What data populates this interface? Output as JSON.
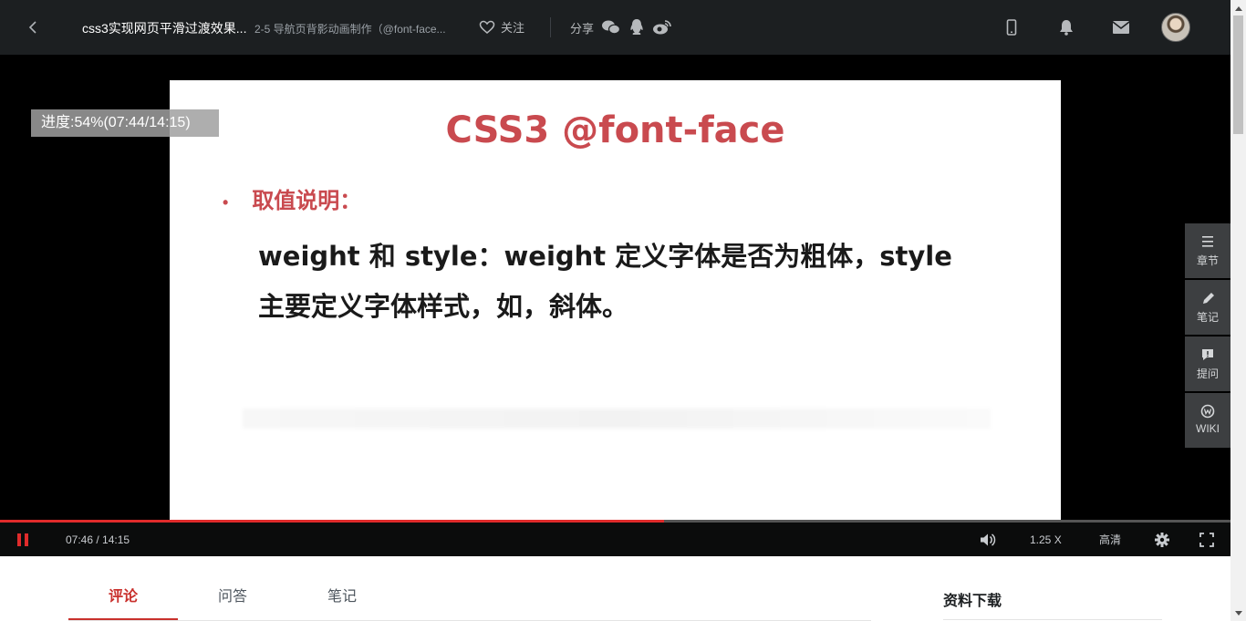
{
  "header": {
    "course_title": "css3实现网页平滑过渡效果...",
    "lesson_title": "2-5 导航页背影动画制作（@font-face...",
    "follow_label": "关注",
    "share_label": "分享"
  },
  "player": {
    "progress_tip": "进度:54%(07:44/14:15)",
    "slide": {
      "title": "CSS3 @font-face",
      "bullet_label": "取值说明：",
      "bullet_dot": "•",
      "body_line1": "weight 和 style：weight 定义字体是否为粗体，style",
      "body_line2": "主要定义字体样式，如，斜体。"
    },
    "side_nav": [
      {
        "label": "章节"
      },
      {
        "label": "笔记"
      },
      {
        "label": "提问"
      },
      {
        "label": "WIKI"
      }
    ],
    "played_fraction": 0.54,
    "time": "07:46 / 14:15",
    "speed": "1.25 X",
    "quality": "高清"
  },
  "tabs": [
    {
      "label": "评论"
    },
    {
      "label": "问答"
    },
    {
      "label": "笔记"
    }
  ],
  "resources_title": "资料下载",
  "colors": {
    "accent": "#c9302c",
    "progress": "#e02b2b",
    "header_bg": "#1c1f21"
  }
}
